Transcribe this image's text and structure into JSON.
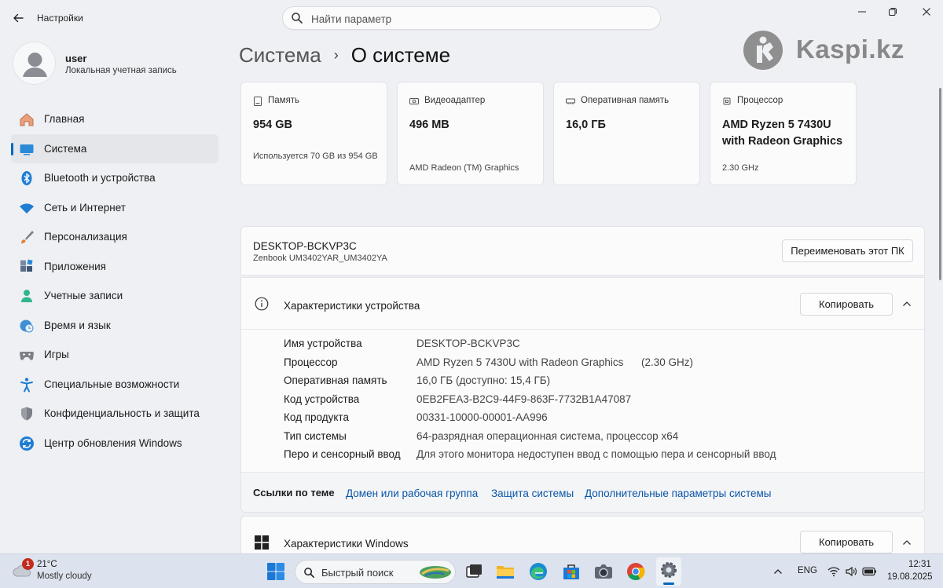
{
  "window": {
    "title": "Настройки",
    "back_icon": "arrow-left-icon",
    "minimize_icon": "minimize-icon",
    "maximize_icon": "restore-icon",
    "close_icon": "close-icon"
  },
  "search": {
    "placeholder": "Найти параметр"
  },
  "profile": {
    "name": "user",
    "account_type": "Локальная учетная запись"
  },
  "sidebar": {
    "items": [
      {
        "label": "Главная",
        "icon": "home-icon",
        "active": false
      },
      {
        "label": "Система",
        "icon": "system-icon",
        "active": true
      },
      {
        "label": "Bluetooth и устройства",
        "icon": "bluetooth-icon",
        "active": false
      },
      {
        "label": "Сеть и Интернет",
        "icon": "wifi-icon",
        "active": false
      },
      {
        "label": "Персонализация",
        "icon": "brush-icon",
        "active": false
      },
      {
        "label": "Приложения",
        "icon": "apps-icon",
        "active": false
      },
      {
        "label": "Учетные записи",
        "icon": "person-icon",
        "active": false
      },
      {
        "label": "Время и язык",
        "icon": "globe-clock-icon",
        "active": false
      },
      {
        "label": "Игры",
        "icon": "gamepad-icon",
        "active": false
      },
      {
        "label": "Специальные возможности",
        "icon": "accessibility-icon",
        "active": false
      },
      {
        "label": "Конфиденциальность и защита",
        "icon": "shield-icon",
        "active": false
      },
      {
        "label": "Центр обновления Windows",
        "icon": "update-icon",
        "active": false
      }
    ]
  },
  "breadcrumb": {
    "parent": "Система",
    "separator": "›",
    "current": "О системе"
  },
  "watermark": {
    "text": "Kaspi.kz"
  },
  "cards": [
    {
      "title": "Память",
      "icon": "storage-icon",
      "value": "954 GB",
      "sub": "Используется 70 GB из 954 GB"
    },
    {
      "title": "Видеоадаптер",
      "icon": "gpu-icon",
      "value": "496 MB",
      "sub": "AMD Radeon (TM) Graphics"
    },
    {
      "title": "Оперативная память",
      "icon": "ram-icon",
      "value": "16,0 ГБ",
      "sub": ""
    },
    {
      "title": "Процессор",
      "icon": "cpu-icon",
      "value": "AMD Ryzen 5 7430U with Radeon Graphics",
      "sub": "2.30 GHz"
    }
  ],
  "pc": {
    "name": "DESKTOP-BCKVP3C",
    "model": "Zenbook UM3402YAR_UM3402YA",
    "rename_button": "Переименовать этот ПК"
  },
  "device_specs": {
    "title": "Характеристики устройства",
    "copy_button": "Копировать",
    "rows": [
      {
        "key": "Имя устройства",
        "value": "DESKTOP-BCKVP3C",
        "extra": ""
      },
      {
        "key": "Процессор",
        "value": "AMD Ryzen 5 7430U with Radeon Graphics",
        "extra": "(2.30 GHz)"
      },
      {
        "key": "Оперативная память",
        "value": "16,0 ГБ (доступно: 15,4 ГБ)",
        "extra": ""
      },
      {
        "key": "Код устройства",
        "value": "0EB2FEA3-B2C9-44F9-863F-7732B1A47087",
        "extra": ""
      },
      {
        "key": "Код продукта",
        "value": "00331-10000-00001-AA996",
        "extra": ""
      },
      {
        "key": "Тип системы",
        "value": "64-разрядная операционная система, процессор x64",
        "extra": ""
      },
      {
        "key": "Перо и сенсорный ввод",
        "value": "Для этого монитора недоступен ввод с помощью пера и сенсорный ввод",
        "extra": ""
      }
    ]
  },
  "related_links": {
    "title": "Ссылки по теме",
    "links": [
      "Домен или рабочая группа",
      "Защита системы",
      "Дополнительные параметры системы"
    ]
  },
  "windows_specs": {
    "title": "Характеристики Windows",
    "copy_button": "Копировать"
  },
  "taskbar": {
    "weather_temp": "21°C",
    "weather_condition": "Mostly cloudy",
    "weather_badge": "1",
    "search_label": "Быстрый поиск",
    "language": "ENG",
    "time": "12:31",
    "date": "19.08.2025",
    "pinned": [
      "start-icon",
      "task-view-icon",
      "file-explorer-icon",
      "edge-icon",
      "store-icon",
      "camera-icon",
      "chrome-icon",
      "settings-icon"
    ]
  }
}
